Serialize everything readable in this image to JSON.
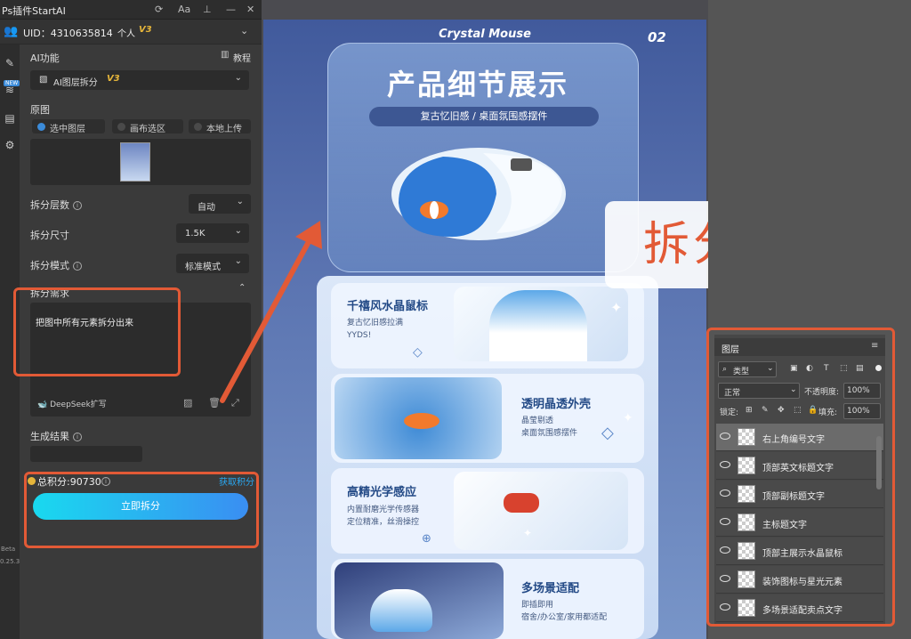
{
  "plugin": {
    "title": "Ps插件StartAI",
    "font_btn": "Aa",
    "uid": "UID：4310635814",
    "plan": "个人",
    "plan_ver": "V3",
    "new_badge": "NEW",
    "ai_func_label": "AI功能",
    "tutorial": "教程",
    "feature": "AI图层拆分",
    "feature_ver": "V3",
    "source_label": "原图",
    "source_opts": [
      "选中图层",
      "画布选区",
      "本地上传"
    ],
    "layers_label": "拆分层数",
    "layers_value": "自动",
    "size_label": "拆分尺寸",
    "size_value": "1.5K",
    "mode_label": "拆分模式",
    "mode_value": "标准模式",
    "need_label": "拆分需求",
    "need_text": "把图中所有元素拆分出来",
    "deepseek": "DeepSeek扩写",
    "result_label": "生成结果",
    "credits": "总积分:90730",
    "get_credits": "获取积分",
    "split_btn": "立即拆分",
    "beta": "Beta",
    "version": "0.25.3"
  },
  "poster": {
    "brand": "Crystal Mouse",
    "page_no": "02",
    "title": "产品细节展示",
    "subtitle": "复古忆旧感 / 桌面氛围感摆件",
    "cards": [
      {
        "title": "千禧风水晶鼠标",
        "desc": [
          "复古忆旧感拉满",
          "YYDS!"
        ]
      },
      {
        "title": "透明晶透外壳",
        "desc": [
          "晶莹剔透",
          "桌面氛围感摆件"
        ]
      },
      {
        "title": "高精光学感应",
        "desc": [
          "内置耐磨光学传感器",
          "定位精准，丝滑操控"
        ]
      },
      {
        "title": "多场景适配",
        "desc": [
          "即插即用",
          "宿舍/办公室/家用都适配"
        ]
      }
    ]
  },
  "effect_label": "拆分效果",
  "layers_panel": {
    "tab": "图层",
    "filter": "类型",
    "blend": "正常",
    "opacity_label": "不透明度:",
    "opacity": "100%",
    "lock_label": "锁定:",
    "fill_label": "填充:",
    "fill": "100%",
    "layers": [
      "右上角编号文字",
      "顶部英文标题文字",
      "顶部副标题文字",
      "主标题文字",
      "顶部主展示水晶鼠标",
      "装饰图标与星光元素",
      "多场景适配卖点文字"
    ]
  },
  "colors": {
    "accent_red": "#e25a36",
    "btn_start": "#19d9ef",
    "btn_end": "#3a8ef2",
    "gold": "#e5b53a"
  }
}
